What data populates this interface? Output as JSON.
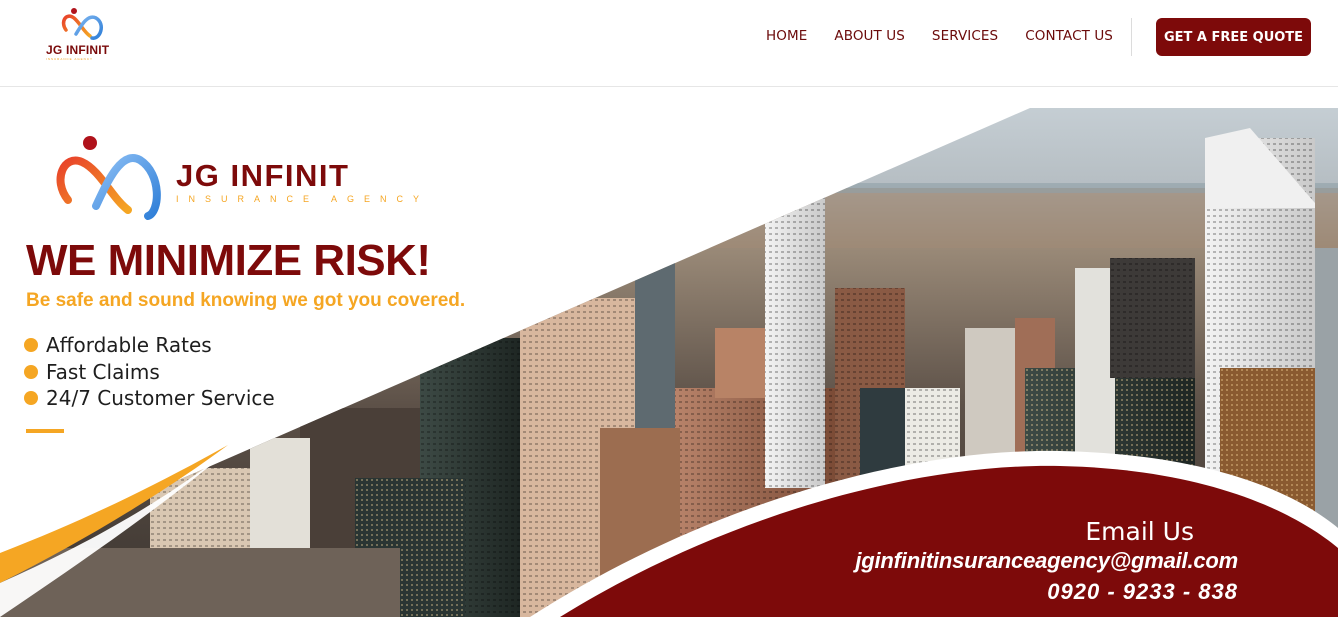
{
  "header": {
    "logo": {
      "name": "JG INFINIT",
      "subtitle": "INSURANCE AGENCY"
    },
    "nav": [
      {
        "label": "HOME"
      },
      {
        "label": "ABOUT US"
      },
      {
        "label": "SERVICES"
      },
      {
        "label": "CONTACT US"
      }
    ],
    "cta_label": "GET A FREE QUOTE"
  },
  "hero": {
    "brand": {
      "name": "JG INFINIT",
      "subtitle": "INSURANCE AGENCY"
    },
    "headline": "WE MINIMIZE RISK!",
    "tagline": "Be safe and sound knowing we got you covered.",
    "features": [
      "Affordable Rates",
      "Fast Claims",
      "24/7 Customer Service"
    ],
    "contact": {
      "title": "Email Us",
      "email": "jginfinitinsuranceagency@gmail.com",
      "phone": "0920 - 9233 - 838"
    },
    "background_image": "city-skyline-aerial"
  },
  "colors": {
    "brand_maroon": "#7d0a0a",
    "accent_orange": "#f5a623",
    "logo_blue": "#3a8ee6",
    "logo_red": "#e8412b"
  }
}
